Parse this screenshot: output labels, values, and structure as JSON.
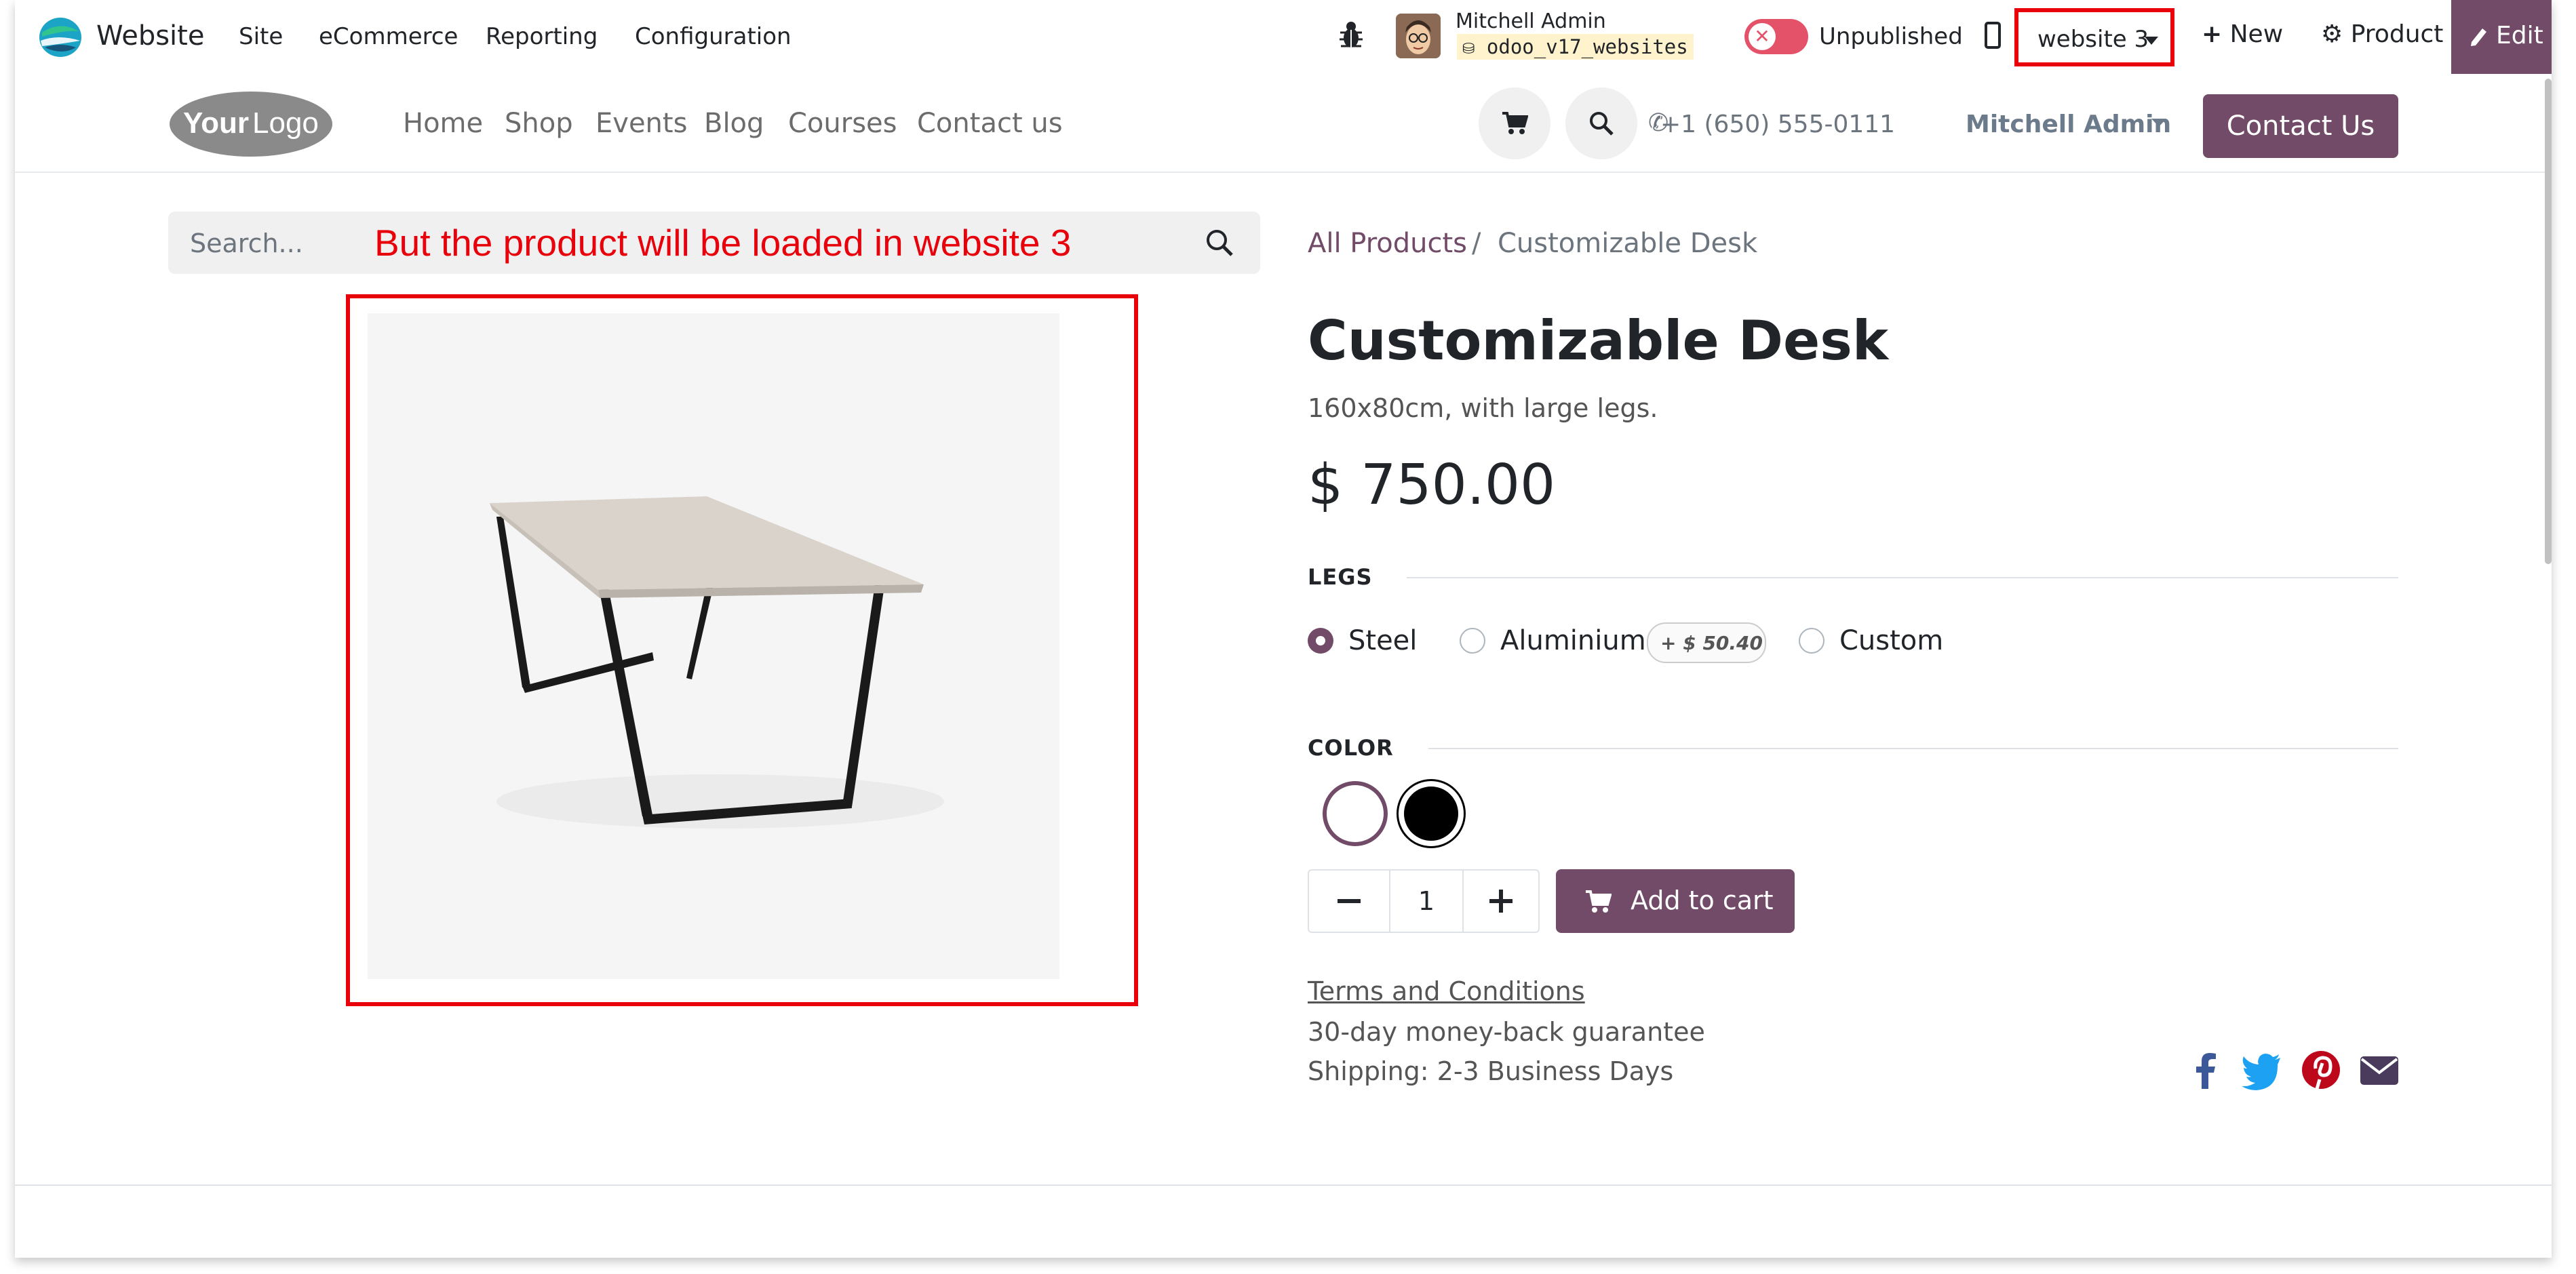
{
  "admin_bar": {
    "app_name": "Website",
    "menus": [
      "Site",
      "eCommerce",
      "Reporting",
      "Configuration"
    ],
    "user_name": "Mitchell Admin",
    "database": "odoo_v17_websites",
    "publish_status": "Unpublished",
    "website_selector": "website 3",
    "new_label": "New",
    "product_label": "Product",
    "edit_label": "Edit"
  },
  "site_nav": {
    "logo_text": "YourLogo",
    "links": [
      "Home",
      "Shop",
      "Events",
      "Blog",
      "Courses",
      "Contact us"
    ],
    "phone": "+1 (650) 555-0111",
    "user_menu": "Mitchell Admin",
    "contact_button": "Contact Us"
  },
  "search": {
    "placeholder": "Search..."
  },
  "annotation": {
    "text": "But the product will be loaded in website 3",
    "color": "#e8000b"
  },
  "breadcrumb": {
    "parent": "All Products",
    "separator": "/",
    "current": "Customizable Desk"
  },
  "product": {
    "name": "Customizable Desk",
    "description": "160x80cm, with large legs.",
    "price": "$ 750.00",
    "image": "desk-with-black-legs"
  },
  "attributes": {
    "legs": {
      "label": "LEGS",
      "options": [
        "Steel",
        "Aluminium",
        "Custom"
      ],
      "selected": "Steel",
      "extra_price": "+ $ 50.40"
    },
    "color": {
      "label": "COLOR",
      "swatches": [
        "#ffffff",
        "#000000"
      ],
      "selected": "#ffffff"
    }
  },
  "cart": {
    "quantity": "1",
    "add_label": "Add to cart"
  },
  "info": {
    "terms": "Terms and Conditions",
    "guarantee": "30-day money-back guarantee",
    "shipping": "Shipping: 2-3 Business Days"
  },
  "social_icons": [
    "facebook-icon",
    "twitter-icon",
    "pinterest-icon",
    "email-icon"
  ],
  "colors": {
    "brand": "#714b67",
    "annotation_red": "#e8000b",
    "unpublished_toggle": "#e4526a"
  }
}
